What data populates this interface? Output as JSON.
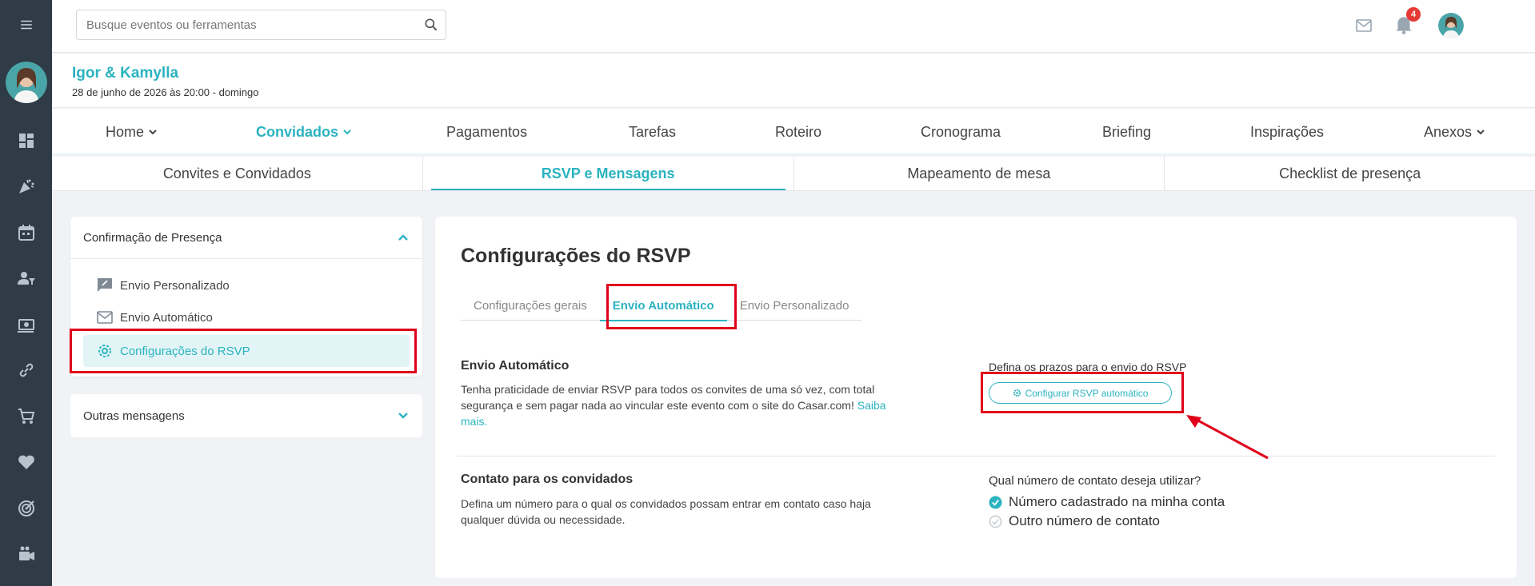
{
  "search": {
    "placeholder": "Busque eventos ou ferramentas"
  },
  "notifications": {
    "count": "4"
  },
  "event": {
    "name": "Igor & Kamylla",
    "date": "28 de junho de 2026 às 20:00 - domingo"
  },
  "main_nav": {
    "items": [
      {
        "label": "Home"
      },
      {
        "label": "Convidados"
      },
      {
        "label": "Pagamentos"
      },
      {
        "label": "Tarefas"
      },
      {
        "label": "Roteiro"
      },
      {
        "label": "Cronograma"
      },
      {
        "label": "Briefing"
      },
      {
        "label": "Inspirações"
      },
      {
        "label": "Anexos"
      }
    ]
  },
  "sub_tabs": {
    "items": [
      {
        "label": "Convites e Convidados"
      },
      {
        "label": "RSVP e Mensagens"
      },
      {
        "label": "Mapeamento de mesa"
      },
      {
        "label": "Checklist de presença"
      }
    ]
  },
  "left_panel": {
    "section_title": "Confirmação de Presença",
    "items": [
      {
        "label": "Envio Personalizado"
      },
      {
        "label": "Envio Automático"
      },
      {
        "label": "Configurações do RSVP"
      }
    ],
    "other_title": "Outras mensagens"
  },
  "main": {
    "title": "Configurações do RSVP",
    "tabs": [
      {
        "label": "Configurações gerais"
      },
      {
        "label": "Envio Automático"
      },
      {
        "label": "Envio Personalizado"
      }
    ],
    "auto": {
      "heading": "Envio Automático",
      "text_1": "Tenha praticidade de enviar RSVP para todos os convites de uma só vez, com total",
      "text_2": "segurança e sem pagar nada ao vincular este evento com o site do Casar.com!",
      "link_1": "Saiba",
      "link_2": "mais.",
      "deadline_label": "Defina os prazos para o envio do RSVP",
      "configure_button": "Configurar RSVP automático"
    },
    "contact": {
      "heading": "Contato para os convidados",
      "text_1": "Defina um número para o qual os convidados possam entrar em contato caso haja",
      "text_2": "qualquer dúvida ou necessidade.",
      "question": "Qual número de contato deseja utilizar?",
      "option_1": "Número cadastrado na minha conta",
      "option_2": "Outro número de contato"
    }
  },
  "colors": {
    "accent": "#2bb3c0",
    "sidebar": "#2f3b47",
    "highlight": "#e0001a"
  }
}
